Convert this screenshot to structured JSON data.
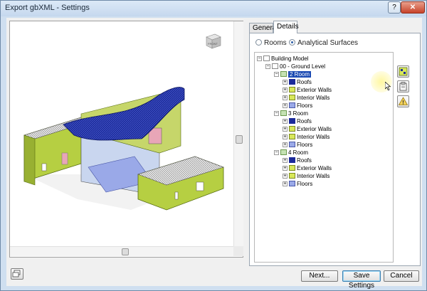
{
  "window": {
    "title": "Export gbXML - Settings",
    "help_label": "?",
    "close_label": "✕"
  },
  "viewcube": {
    "label": "FRONT"
  },
  "tabs": [
    {
      "label": "General",
      "active": false
    },
    {
      "label": "Details",
      "active": true
    }
  ],
  "radios": {
    "rooms": {
      "label": "Rooms",
      "selected": false
    },
    "analytical": {
      "label": "Analytical Surfaces",
      "selected": true
    }
  },
  "tree": {
    "root": "Building Model",
    "level": "00 - Ground Level",
    "rooms": [
      {
        "name": "2 Room",
        "selected": true,
        "children": [
          "Roofs",
          "Exterior Walls",
          "Interior Walls",
          "Floors"
        ]
      },
      {
        "name": "3 Room",
        "selected": false,
        "children": [
          "Roofs",
          "Exterior Walls",
          "Interior Walls",
          "Floors"
        ]
      },
      {
        "name": "4 Room",
        "selected": false,
        "children": [
          "Roofs",
          "Exterior Walls",
          "Interior Walls",
          "Floors"
        ]
      }
    ]
  },
  "side_icons": [
    "building-tree-icon",
    "clipboard-icon",
    "warning-icon"
  ],
  "buttons": {
    "next": "Next...",
    "save": "Save Settings",
    "cancel": "Cancel"
  },
  "colors": {
    "roof": "#1b2a9a",
    "walls": "#b6cf42",
    "floors": "#9aa9e8",
    "selection": "#1c4bb3"
  }
}
